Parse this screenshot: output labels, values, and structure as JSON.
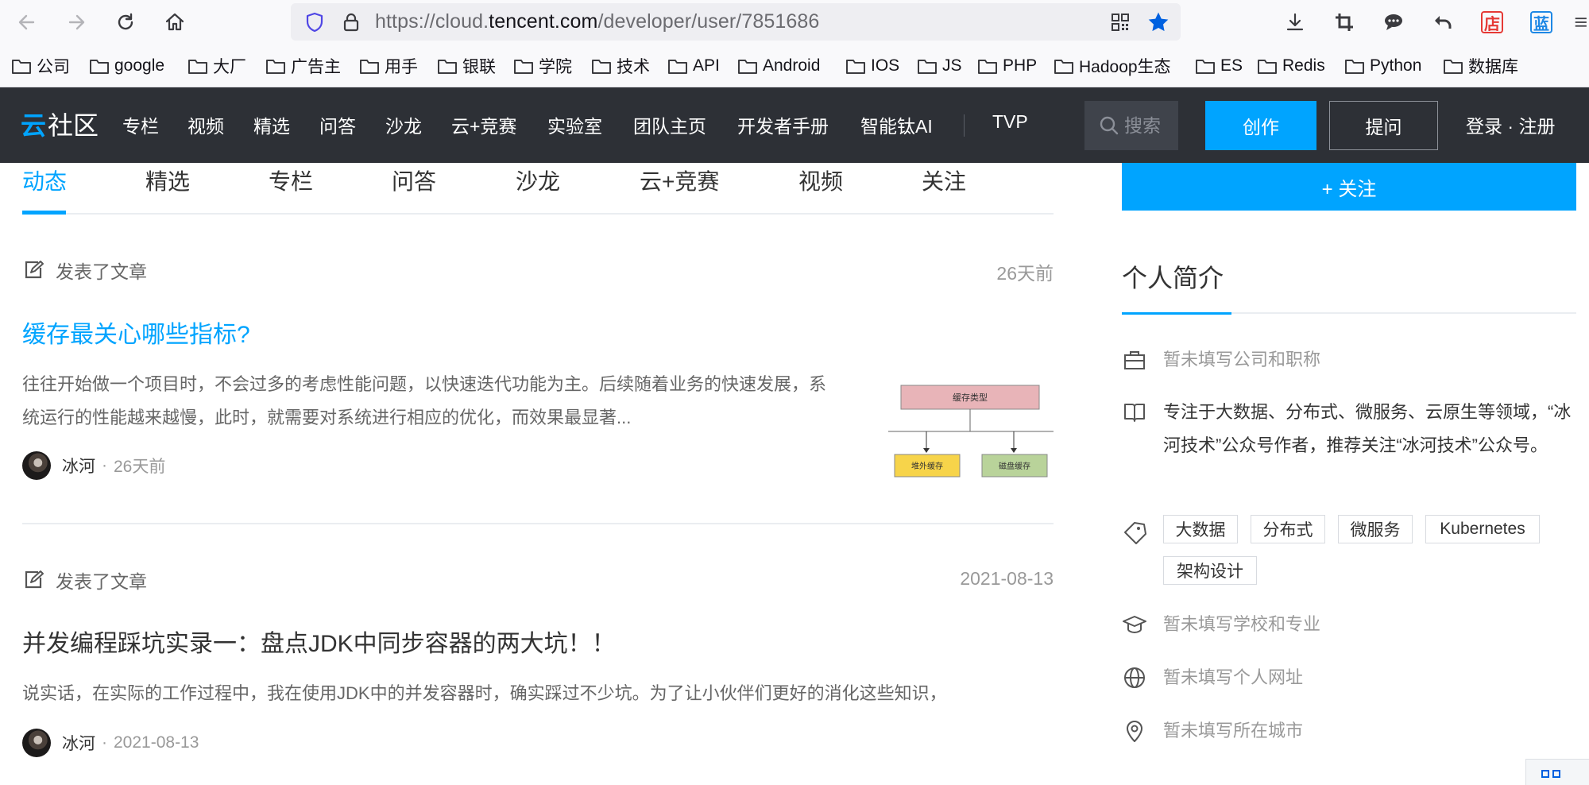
{
  "browser": {
    "url_prefix": "https://cloud.",
    "url_domain": "tencent.com",
    "url_path": "/developer/user/7851686"
  },
  "bookmarks": [
    {
      "label": "公司"
    },
    {
      "label": "google"
    },
    {
      "label": "大厂"
    },
    {
      "label": "广告主"
    },
    {
      "label": "用手"
    },
    {
      "label": "银联"
    },
    {
      "label": "学院"
    },
    {
      "label": "技术"
    },
    {
      "label": "API"
    },
    {
      "label": "Android"
    },
    {
      "label": "IOS"
    },
    {
      "label": "JS"
    },
    {
      "label": "PHP"
    },
    {
      "label": "Hadoop生态"
    },
    {
      "label": "ES"
    },
    {
      "label": "Redis"
    },
    {
      "label": "Python"
    },
    {
      "label": "数据库"
    }
  ],
  "header": {
    "logo_mark": "云",
    "logo_text": "社区",
    "nav": [
      "专栏",
      "视频",
      "精选",
      "问答",
      "沙龙",
      "云+竞赛",
      "实验室",
      "团队主页",
      "开发者手册",
      "智能钛AI"
    ],
    "nav_tvp": "TVP",
    "search_placeholder": "搜索",
    "create_label": "创作",
    "ask_label": "提问",
    "login_label": "登录 · 注册"
  },
  "tabs": [
    "动态",
    "精选",
    "专栏",
    "问答",
    "沙龙",
    "云+竞赛",
    "视频",
    "关注"
  ],
  "feed": [
    {
      "action": "发表了文章",
      "time": "26天前",
      "title": "缓存最关心哪些指标?",
      "desc": "往往开始做一个项目时，不会过多的考虑性能问题，以快速迭代功能为主。后续随着业务的快速发展，系统运行的性能越来越慢，此时，就需要对系统进行相应的优化，而效果最显著...",
      "author": "冰河",
      "author_time": "26天前",
      "thumb": {
        "top": "缓存类型",
        "left": "堆外缓存",
        "right": "磁盘缓存"
      }
    },
    {
      "action": "发表了文章",
      "time": "2021-08-13",
      "title": "并发编程踩坑实录一：盘点JDK中同步容器的两大坑！！",
      "desc": "说实话，在实际的工作过程中，我在使用JDK中的并发容器时，确实踩过不少坑。为了让小伙伴们更好的消化这些知识，",
      "author": "冰河",
      "author_time": "2021-08-13"
    }
  ],
  "sidebar": {
    "follow_label": "+ 关注",
    "profile_title": "个人简介",
    "company": "暂未填写公司和职称",
    "bio": "专注于大数据、分布式、微服务、云原生等领域，“冰河技术”公众号作者，推荐关注“冰河技术”公众号。",
    "tags": [
      "大数据",
      "分布式",
      "微服务",
      "Kubernetes",
      "架构设计"
    ],
    "school": "暂未填写学校和专业",
    "website": "暂未填写个人网址",
    "city": "暂未填写所在城市"
  },
  "colors": {
    "accent": "#00a4ff",
    "header_bg": "#2d3036",
    "browser_bg": "#f9f9fb"
  }
}
